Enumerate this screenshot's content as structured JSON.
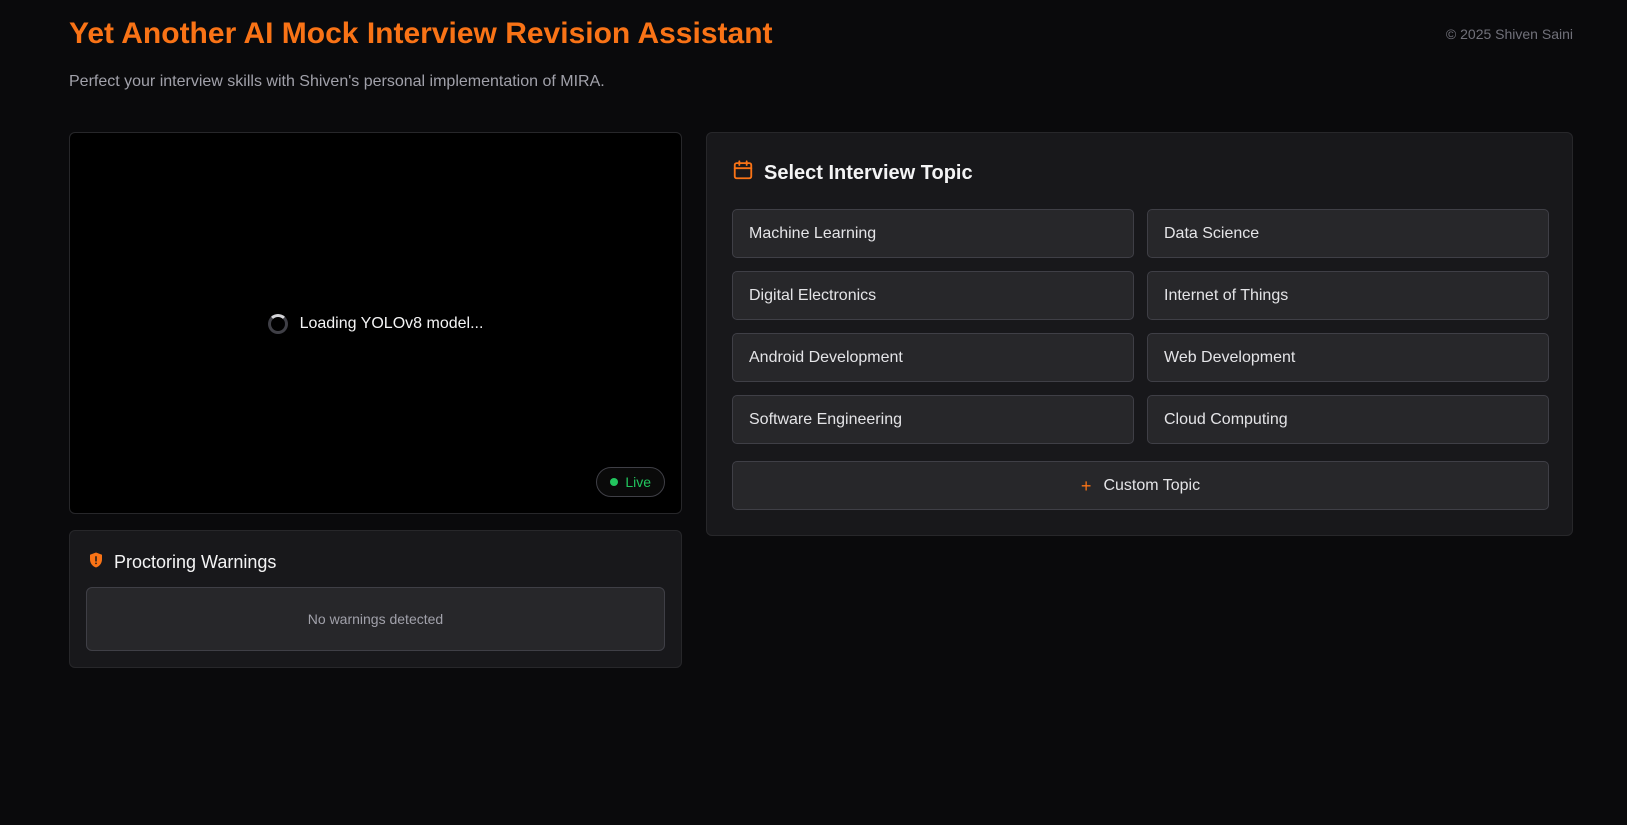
{
  "header": {
    "title": "Yet Another AI Mock Interview Revision Assistant",
    "subtitle": "Perfect your interview skills with Shiven's personal implementation of MIRA.",
    "copyright": "© 2025 Shiven Saini"
  },
  "video": {
    "loading_text": "Loading YOLOv8 model...",
    "live_label": "Live"
  },
  "proctoring": {
    "title": "Proctoring Warnings",
    "empty_text": "No warnings detected"
  },
  "topics": {
    "title": "Select Interview Topic",
    "items": [
      {
        "label": "Machine Learning"
      },
      {
        "label": "Data Science"
      },
      {
        "label": "Digital Electronics"
      },
      {
        "label": "Internet of Things"
      },
      {
        "label": "Android Development"
      },
      {
        "label": "Web Development"
      },
      {
        "label": "Software Engineering"
      },
      {
        "label": "Cloud Computing"
      }
    ],
    "custom_label": "Custom Topic"
  },
  "colors": {
    "accent": "#f97316",
    "live": "#22c55e",
    "background": "#0a0a0c",
    "panel": "#18181b"
  },
  "icons": {
    "topic_header": "calendar-icon",
    "warnings_header": "shield-alert-icon",
    "custom": "plus-icon",
    "loading": "spinner-icon"
  }
}
